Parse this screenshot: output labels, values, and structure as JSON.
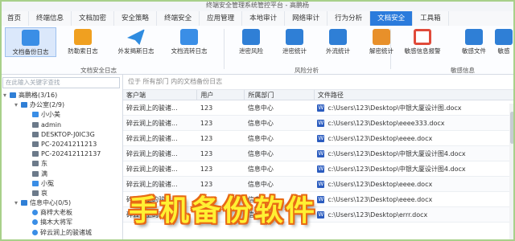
{
  "app": {
    "title": "终端安全管理系统管控平台 - 高鹏杨"
  },
  "menu": {
    "tabs": [
      "首页",
      "终端信息",
      "文档加密",
      "安全策略",
      "终端安全",
      "应用管理",
      "本地审计",
      "网络审计",
      "行为分析",
      "文档安全",
      "工具箱"
    ],
    "active": "文档安全"
  },
  "ribbon": {
    "buttons": [
      {
        "label": "文档备份日志",
        "icon": "folder-icon",
        "active": true
      },
      {
        "label": "防勒索日志",
        "icon": "shield-icon",
        "active": false
      },
      {
        "label": "外发揭斯日志",
        "icon": "paper-plane-icon",
        "active": false
      },
      {
        "label": "文档流转日志",
        "icon": "cycle-icon",
        "active": false
      },
      {
        "label": "泄密风险",
        "icon": "warning-shield-icon",
        "active": false
      },
      {
        "label": "泄密统计",
        "icon": "shield-stats-icon",
        "active": false
      },
      {
        "label": "外流统计",
        "icon": "folder-export-icon",
        "active": false
      },
      {
        "label": "解密统计",
        "icon": "unlock-icon",
        "active": false
      },
      {
        "label": "敏感信息报警",
        "icon": "no-entry-icon",
        "active": false
      },
      {
        "label": "敏感文件",
        "icon": "sensitive-file-icon",
        "active": false
      },
      {
        "label": "敏感",
        "icon": "sensitive-icon",
        "active": false
      }
    ],
    "groups": [
      "文档安全日志",
      "风险分析",
      "敏感信息"
    ]
  },
  "sidebar": {
    "search_placeholder": "在此输入关键字查找",
    "tree": [
      {
        "label": "高鹏格(3/16)",
        "level": 0,
        "type": "grp",
        "toggle": "▾"
      },
      {
        "label": "办公室(2/9)",
        "level": 1,
        "type": "grp",
        "toggle": "▾"
      },
      {
        "label": "小小美",
        "level": 2,
        "type": "sel",
        "toggle": ""
      },
      {
        "label": "admin",
        "level": 2,
        "type": "pc",
        "toggle": ""
      },
      {
        "label": "DESKTOP-J0IC3G",
        "level": 2,
        "type": "pc",
        "toggle": ""
      },
      {
        "label": "PC-20241211213",
        "level": 2,
        "type": "pc",
        "toggle": ""
      },
      {
        "label": "PC-202412112137",
        "level": 2,
        "type": "pc",
        "toggle": ""
      },
      {
        "label": "东",
        "level": 2,
        "type": "pc",
        "toggle": ""
      },
      {
        "label": "满",
        "level": 2,
        "type": "pc",
        "toggle": ""
      },
      {
        "label": "小冤",
        "level": 2,
        "type": "sel",
        "toggle": ""
      },
      {
        "label": "哀",
        "level": 2,
        "type": "pc",
        "toggle": ""
      },
      {
        "label": "信息中心(0/5)",
        "level": 1,
        "type": "grp",
        "toggle": "▾"
      },
      {
        "label": "商梓大老板",
        "level": 2,
        "type": "user",
        "toggle": ""
      },
      {
        "label": "搞木大将军",
        "level": 2,
        "type": "user",
        "toggle": ""
      },
      {
        "label": "碎云涧上的骏诸城",
        "level": 2,
        "type": "user",
        "toggle": ""
      }
    ]
  },
  "main": {
    "path": "位于 所有部门 内的文档备份日志",
    "columns": [
      "客户端",
      "用户",
      "所属部门",
      "文件路径"
    ],
    "rows": [
      [
        "碎云涧上的骏诸...",
        "123",
        "信息中心",
        "c:\\Users\\123\\Desktop\\中银大厦设计图.docx"
      ],
      [
        "碎云涧上的骏诸...",
        "123",
        "信息中心",
        "c:\\Users\\123\\Desktop\\eeee333.docx"
      ],
      [
        "碎云涧上的骏诸...",
        "123",
        "信息中心",
        "c:\\Users\\123\\Desktop\\eeee.docx"
      ],
      [
        "碎云涧上的骏诸...",
        "123",
        "信息中心",
        "c:\\Users\\123\\Desktop\\中银大厦设计图4.docx"
      ],
      [
        "碎云涧上的骏诸...",
        "123",
        "信息中心",
        "c:\\Users\\123\\Desktop\\中银大厦设计图4.docx"
      ],
      [
        "碎云涧上的骏诸...",
        "123",
        "信息中心",
        "c:\\Users\\123\\Desktop\\eeee.docx"
      ],
      [
        "碎云涧上的骏诸...",
        "123",
        "信息中心",
        "c:\\Users\\123\\Desktop\\eeee.docx"
      ],
      [
        "碎云涧上的骏诸...",
        "123",
        "信息中心",
        "c:\\Users\\123\\Desktop\\errr.docx"
      ]
    ]
  },
  "banner": {
    "text": "手机备份软件"
  }
}
